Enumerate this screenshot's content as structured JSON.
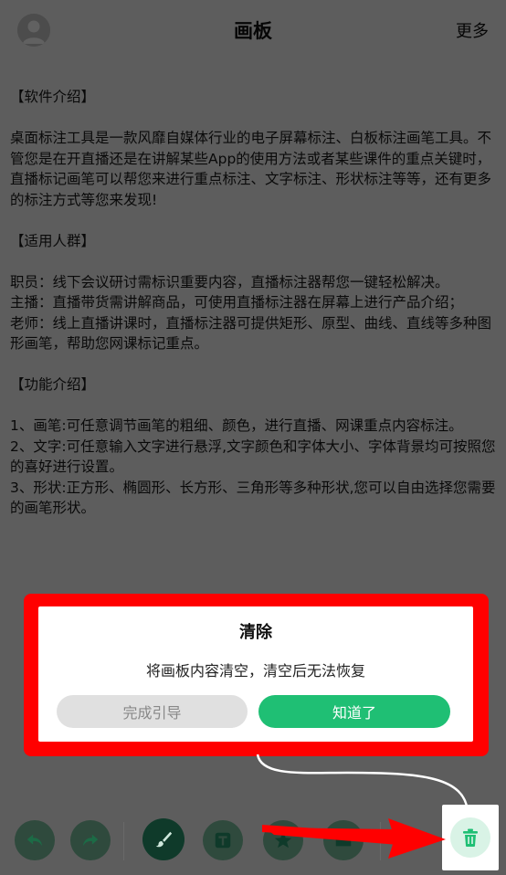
{
  "header": {
    "title": "画板",
    "more_label": "更多"
  },
  "content": {
    "lines": [
      "【软件介绍】",
      "",
      "桌面标注工具是一款风靡自媒体行业的电子屏幕标注、白板标注画笔工具。不管您是在开直播还是在讲解某些App的使用方法或者某些课件的重点关键时，直播标记画笔可以帮您来进行重点标注、文字标注、形状标注等等，还有更多的标注方式等您来发现!",
      "",
      "【适用人群】",
      "",
      "职员：线下会议研讨需标识重要内容，直播标注器帮您一键轻松解决。",
      "主播：直播带货需讲解商品，可使用直播标注器在屏幕上进行产品介绍；",
      "老师：线上直播讲课时，直播标注器可提供矩形、原型、曲线、直线等多种图形画笔，帮助您网课标记重点。",
      "",
      "【功能介绍】",
      "",
      "1、画笔:可任意调节画笔的粗细、颜色，进行直播、网课重点内容标注。",
      "2、文字:可任意输入文字进行悬浮,文字颜色和字体大小、字体背景均可按照您的喜好进行设置。",
      "3、形状:正方形、椭圆形、长方形、三角形等多种形状,您可以自由选择您需要的画笔形状。"
    ]
  },
  "dialog": {
    "title": "清除",
    "message": "将画板内容清空，清空后无法恢复",
    "guide_button": "完成引导",
    "ok_button": "知道了"
  },
  "toolbar": {
    "tools": [
      "undo-icon",
      "redo-icon",
      "brush-icon",
      "text-icon",
      "star-shape-icon",
      "folder-icon",
      "trash-icon"
    ]
  },
  "colors": {
    "accent": "#1fbf74",
    "highlight_frame": "#ff0000",
    "trash_bg": "#d9f3e6",
    "tool_bg": "#2f4a3d"
  }
}
